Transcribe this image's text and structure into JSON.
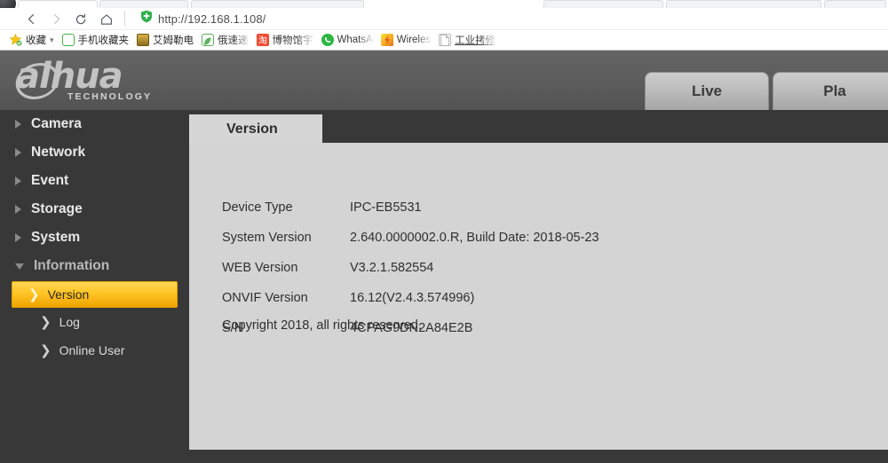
{
  "browser": {
    "nav": {
      "back_label": "Back",
      "forward_label": "Forward",
      "reload_label": "Reload",
      "home_label": "Home"
    },
    "address_bar": {
      "url": "http://192.168.1.108/",
      "security_icon": "green-shield-icon"
    },
    "bookmarks": [
      {
        "label": "收藏",
        "icon": "star-icon",
        "has_caret": true
      },
      {
        "label": "手机收藏夹",
        "icon": "phone-icon"
      },
      {
        "label": "艾姆勒电",
        "icon": "amur-icon"
      },
      {
        "label": "俄速递",
        "icon": "leaf-icon",
        "faded": true
      },
      {
        "label": "博物馆宇",
        "icon": "taobao-icon",
        "faded": true
      },
      {
        "label": "WhatsA",
        "icon": "whatsapp-icon",
        "faded": true
      },
      {
        "label": "Wireles",
        "icon": "wireless-icon",
        "faded": true
      },
      {
        "label": "工业拷修",
        "icon": "document-icon",
        "underline": true,
        "faded": true
      }
    ]
  },
  "webui": {
    "logo": {
      "wordmark": "alhua",
      "tagline": "TECHNOLOGY"
    },
    "top_tabs": [
      {
        "label": "Live",
        "active": false
      },
      {
        "label": "Pla",
        "active": false
      }
    ],
    "sidebar": {
      "groups": [
        {
          "label": "Camera",
          "expanded": false
        },
        {
          "label": "Network",
          "expanded": false
        },
        {
          "label": "Event",
          "expanded": false
        },
        {
          "label": "Storage",
          "expanded": false
        },
        {
          "label": "System",
          "expanded": false
        },
        {
          "label": "Information",
          "expanded": true
        }
      ],
      "information_items": [
        {
          "label": "Version",
          "active": true
        },
        {
          "label": "Log",
          "active": false
        },
        {
          "label": "Online User",
          "active": false
        }
      ]
    },
    "panel": {
      "tab_label": "Version",
      "rows": [
        {
          "key": "Device Type",
          "value": "IPC-EB5531"
        },
        {
          "key": "System Version",
          "value": "2.640.0000002.0.R, Build Date: 2018-05-23"
        },
        {
          "key": "WEB Version",
          "value": "V3.2.1.582554"
        },
        {
          "key": "ONVIF Version",
          "value": "16.12(V2.4.3.574996)"
        },
        {
          "key": "S/N",
          "value": "4CPAG9DN2A84E2B"
        }
      ],
      "copyright": "Copyright 2018, all rights reserved."
    },
    "colors": {
      "accent": "#ffc425",
      "header": "#5c5c5c",
      "background": "#383838",
      "panel": "#d4d4d4"
    }
  }
}
